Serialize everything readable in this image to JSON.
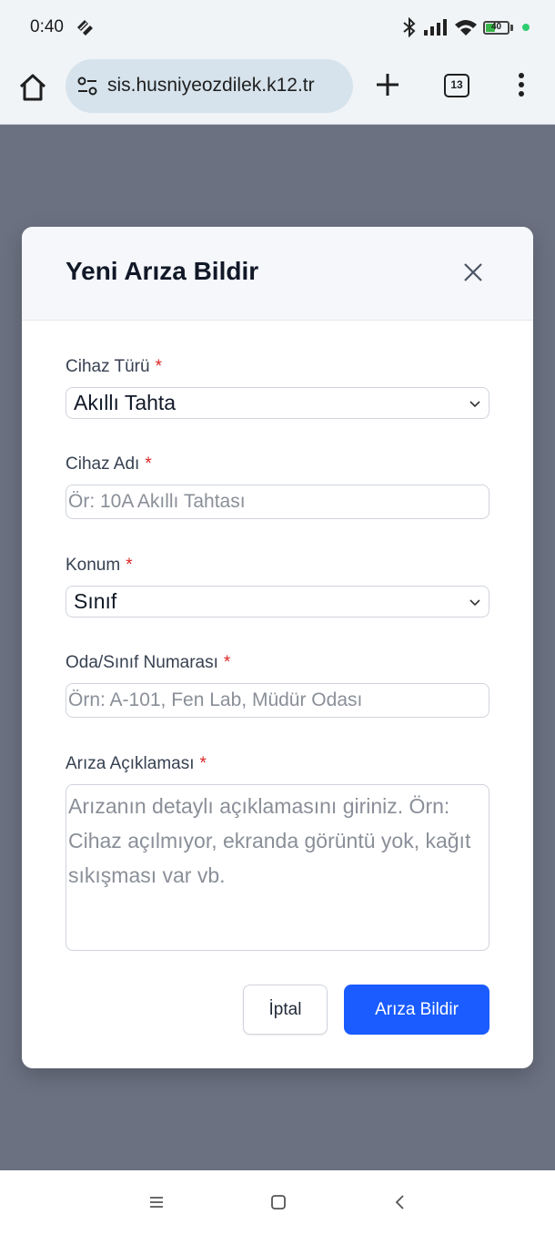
{
  "status_bar": {
    "time": "0:40",
    "battery_level": "40",
    "icons": [
      "signal-alt-icon",
      "bluetooth-icon",
      "cell-signal-icon",
      "wifi-icon",
      "battery-icon",
      "dot-indicator-icon"
    ]
  },
  "browser": {
    "url": "sis.husniyeozdilek.k12.tr",
    "tab_count": "13",
    "icons": [
      "home-icon",
      "site-settings-icon",
      "new-tab-icon",
      "tab-switcher-icon",
      "more-menu-icon"
    ]
  },
  "modal": {
    "title": "Yeni Arıza Bildir",
    "fields": {
      "device_type": {
        "label": "Cihaz Türü",
        "required_mark": "*",
        "value": "Akıllı Tahta"
      },
      "device_name": {
        "label": "Cihaz Adı",
        "required_mark": "*",
        "placeholder": "Ör: 10A Akıllı Tahtası"
      },
      "location": {
        "label": "Konum",
        "required_mark": "*",
        "value": "Sınıf"
      },
      "room_number": {
        "label": "Oda/Sınıf Numarası",
        "required_mark": "*",
        "placeholder": "Örn: A-101, Fen Lab, Müdür Odası"
      },
      "fault_description": {
        "label": "Arıza Açıklaması",
        "required_mark": "*",
        "placeholder": "Arızanın detaylı açıklamasını giriniz. Örn: Cihaz açılmıyor, ekranda görüntü yok, kağıt sıkışması var vb."
      }
    },
    "cancel_label": "İptal",
    "submit_label": "Arıza Bildir"
  },
  "colors": {
    "overlay": "#6b7181",
    "primary": "#1a5cff",
    "required": "#dc2626",
    "url_pill": "#d6e3ec"
  }
}
